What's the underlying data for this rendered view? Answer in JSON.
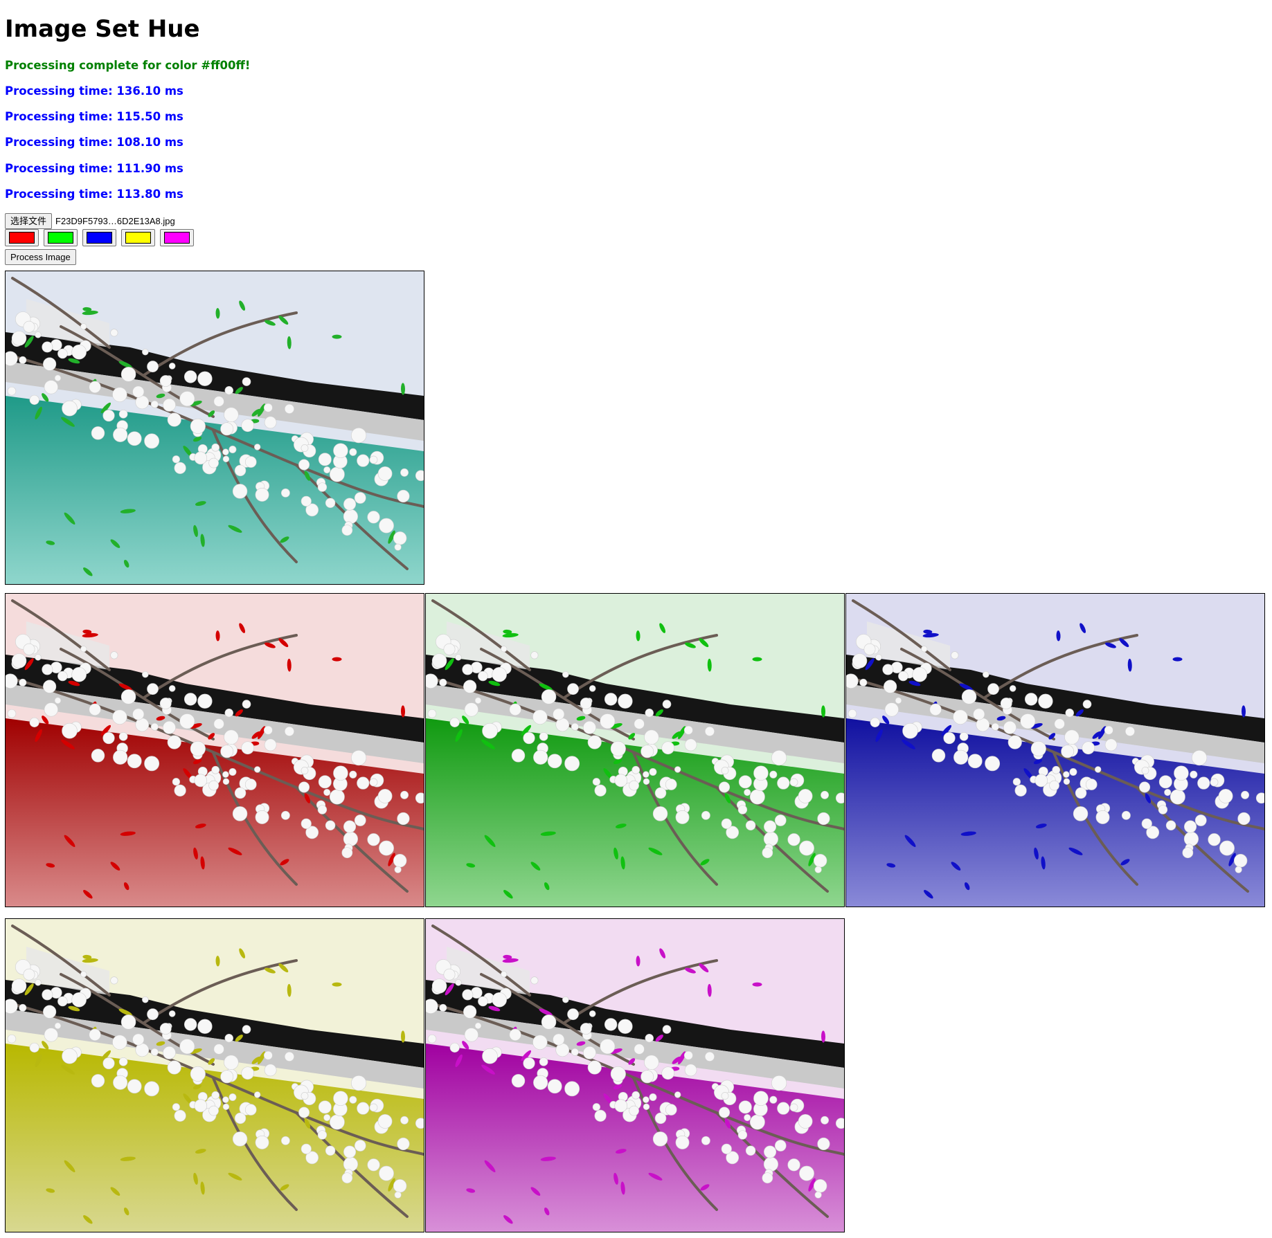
{
  "page": {
    "title": "Image Set Hue",
    "status_complete": "Processing complete for color #ff00ff!",
    "processing_times": [
      "Processing time: 136.10 ms",
      "Processing time: 115.50 ms",
      "Processing time: 108.10 ms",
      "Processing time: 111.90 ms",
      "Processing time: 113.80 ms"
    ]
  },
  "controls": {
    "file_button_label": "选择文件",
    "file_name": "F23D9F5793…6D2E13A8.jpg",
    "color_swatches": [
      {
        "name": "red",
        "color": "#ff0000"
      },
      {
        "name": "green",
        "color": "#00ff00"
      },
      {
        "name": "blue",
        "color": "#0000ff"
      },
      {
        "name": "yellow",
        "color": "#ffff00"
      },
      {
        "name": "magenta",
        "color": "#ff00ff"
      }
    ],
    "process_button_label": "Process Image"
  },
  "colors": {
    "status_complete": "#008000",
    "processing_time": "#0000ff"
  },
  "images": [
    {
      "id": "original",
      "sky": "#dfe5f0",
      "wall_top": "#1f9a88",
      "wall_bottom": "#8fd6cc",
      "leaf": "#22b02a"
    },
    {
      "id": "red",
      "sky": "#f5dcdc",
      "wall_top": "#a00000",
      "wall_bottom": "#d98a8a",
      "leaf": "#d40000"
    },
    {
      "id": "green",
      "sky": "#dcf0dc",
      "wall_top": "#109a10",
      "wall_bottom": "#8fd68f",
      "leaf": "#10c010"
    },
    {
      "id": "blue",
      "sky": "#dcdcf0",
      "wall_top": "#1010a0",
      "wall_bottom": "#8a8ad8",
      "leaf": "#1010c8"
    },
    {
      "id": "yellow",
      "sky": "#f2f2d8",
      "wall_top": "#b8b800",
      "wall_bottom": "#d8d890",
      "leaf": "#b8b810"
    },
    {
      "id": "magenta",
      "sky": "#f2dcf2",
      "wall_top": "#a000a0",
      "wall_bottom": "#d890d8",
      "leaf": "#c810c8"
    }
  ]
}
